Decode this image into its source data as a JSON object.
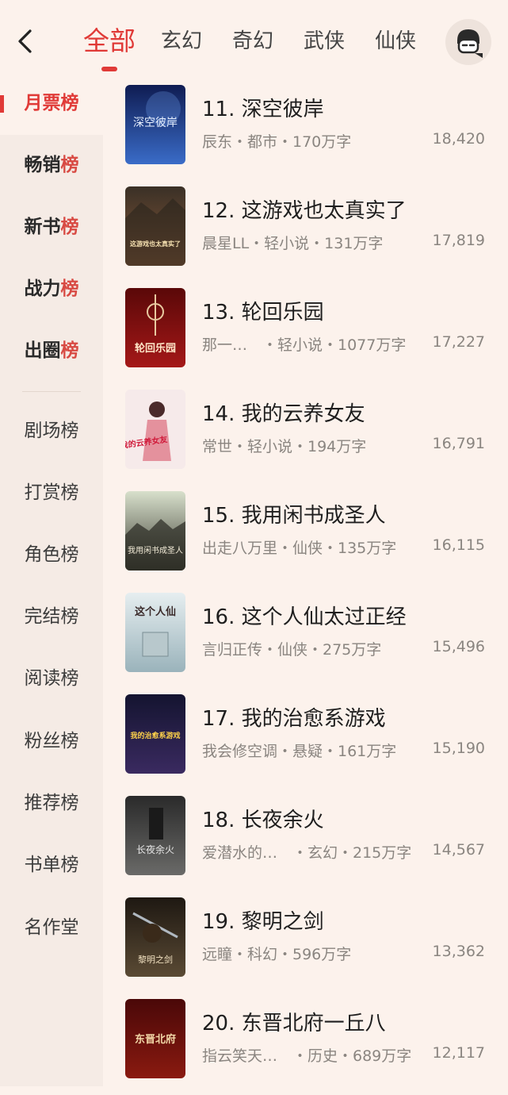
{
  "header": {
    "tabs": [
      {
        "label": "全部",
        "active": true
      },
      {
        "label": "玄幻"
      },
      {
        "label": "奇幻"
      },
      {
        "label": "武侠"
      },
      {
        "label": "仙侠"
      }
    ]
  },
  "sidebar": {
    "hot_items": [
      {
        "head": "月票",
        "tail": "榜",
        "active": true
      },
      {
        "head": "畅销",
        "tail": "榜"
      },
      {
        "head": "新书",
        "tail": "榜"
      },
      {
        "head": "战力",
        "tail": "榜"
      },
      {
        "head": "出圈",
        "tail": "榜"
      }
    ],
    "other_items": [
      "剧场榜",
      "打赏榜",
      "角色榜",
      "完结榜",
      "阅读榜",
      "粉丝榜",
      "推荐榜",
      "书单榜",
      "名作堂"
    ]
  },
  "books": [
    {
      "title": "11. 深空彼岸",
      "meta": "辰东・都市・170万字",
      "count": "18,420",
      "cover_colors": [
        "#1a2a6b",
        "#3a5bb0"
      ]
    },
    {
      "title": "12. 这游戏也太真实了",
      "meta": "晨星LL・轻小说・131万字",
      "count": "17,819",
      "cover_colors": [
        "#5a4a3a",
        "#8a6a50"
      ]
    },
    {
      "title": "13. 轮回乐园",
      "meta": "那一…　・轻小说・1077万字",
      "count": "17,227",
      "cover_colors": [
        "#6a0d0d",
        "#a01818"
      ]
    },
    {
      "title": "14. 我的云养女友",
      "meta": "常世・轻小说・194万字",
      "count": "16,791",
      "cover_colors": [
        "#f3e6e6",
        "#e8b7b7"
      ]
    },
    {
      "title": "15. 我用闲书成圣人",
      "meta": "出走八万里・仙侠・135万字",
      "count": "16,115",
      "cover_colors": [
        "#cfd8c4",
        "#4a4a40"
      ]
    },
    {
      "title": "16. 这个人仙太过正经",
      "meta": "言归正传・仙侠・275万字",
      "count": "15,496",
      "cover_colors": [
        "#d8e6ea",
        "#9fb8c0"
      ]
    },
    {
      "title": "17. 我的治愈系游戏",
      "meta": "我会修空调・悬疑・161万字",
      "count": "15,190",
      "cover_colors": [
        "#1b1b3a",
        "#3a2a60"
      ]
    },
    {
      "title": "18. 长夜余火",
      "meta": "爱潜水的…　・玄幻・215万字",
      "count": "14,567",
      "cover_colors": [
        "#3a3a3a",
        "#6a6a6a"
      ]
    },
    {
      "title": "19. 黎明之剑",
      "meta": "远瞳・科幻・596万字",
      "count": "13,362",
      "cover_colors": [
        "#2a2016",
        "#6a5a40"
      ]
    },
    {
      "title": "20. 东晋北府一丘八",
      "meta": "指云笑天…　・历史・689万字",
      "count": "12,117",
      "cover_colors": [
        "#5a0a0a",
        "#8a1a10"
      ]
    }
  ],
  "cover_text": [
    "深空彼岸",
    "这游戏也太真实了",
    "轮回乐园",
    "我的云养女友",
    "我用闲书成圣人",
    "这个人仙",
    "我的治愈系游戏",
    "长夜余火",
    "黎明之剑",
    "东晋北府"
  ],
  "colors": {
    "accent": "#e03a37",
    "background": "#fcf2ec",
    "sidebar_bg": "#f5ebe5",
    "meta_text": "#8a8580"
  },
  "icons": {
    "back": "chevron-left-icon",
    "avatar": "user-avatar-icon"
  }
}
